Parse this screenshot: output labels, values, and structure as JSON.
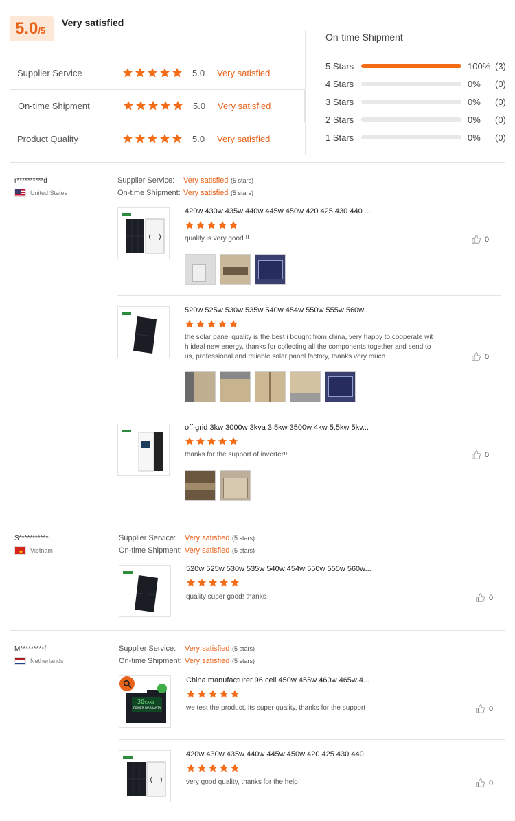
{
  "summary": {
    "score": "5.0",
    "score_max": "/5",
    "overall_text": "Very satisfied",
    "rows": [
      {
        "label": "Supplier Service",
        "value": "5.0",
        "satisfaction": "Very satisfied",
        "stars": 5
      },
      {
        "label": "On-time Shipment",
        "value": "5.0",
        "satisfaction": "Very satisfied",
        "stars": 5
      },
      {
        "label": "Product Quality",
        "value": "5.0",
        "satisfaction": "Very satisfied",
        "stars": 5
      }
    ]
  },
  "shipment": {
    "title": "On-time Shipment",
    "bars": [
      {
        "label": "5  Stars",
        "pct": "100%",
        "count": "(3)",
        "fill": 1.0
      },
      {
        "label": "4  Stars",
        "pct": "0%",
        "count": "(0)",
        "fill": 0
      },
      {
        "label": "3  Stars",
        "pct": "0%",
        "count": "(0)",
        "fill": 0
      },
      {
        "label": "2  Stars",
        "pct": "0%",
        "count": "(0)",
        "fill": 0
      },
      {
        "label": "1  Stars",
        "pct": "0%",
        "count": "(0)",
        "fill": 0
      }
    ]
  },
  "meta_labels": {
    "supplier_service": "Supplier Service:",
    "ontime_shipment": "On-time Shipment:",
    "very_satisfied": "Very satisfied",
    "five_stars": "(5 stars)"
  },
  "reviews": [
    {
      "name": "r**********d",
      "country": "United States",
      "products": [
        {
          "title": "420w 430w 435w 440w 445w 450w 420 425 430 440 ...",
          "comment": "quality is very good  !!",
          "likes": "0",
          "stars": 5
        },
        {
          "title": "520w 525w 530w 535w 540w 454w 550w 555w 560w...",
          "comment_lines": [
            "the solar panel quality is the best i bought from china, very happy to cooperate wit",
            "h ideal new energy, thanks for collecting all the components together and send to",
            "us, professional and reliable solar panel factory, thanks very much"
          ],
          "likes": "0",
          "stars": 5
        },
        {
          "title": "off grid 3kw 3000w 3kva 3.5kw 3500w 4kw 5.5kw 5kv...",
          "comment": "thanks for the support of inverter!!",
          "likes": "0",
          "stars": 5
        }
      ]
    },
    {
      "name": "S***********i",
      "country": "Vietnam",
      "products": [
        {
          "title": "520w 525w 530w 535w 540w 454w 550w 555w 560w...",
          "comment": "quality super good! thanks",
          "likes": "0",
          "stars": 5
        }
      ]
    },
    {
      "name": "M*********f",
      "country": "Netherlands",
      "products": [
        {
          "title": "China manufacturer 96 cell 450w 455w 460w 465w 4...",
          "comment": "we test the product, its super quality, thanks for the support",
          "likes": "0",
          "stars": 5,
          "thumb_text": [
            "30",
            "YEARS",
            "POWER WARRANTY"
          ]
        },
        {
          "title": "420w 430w 435w 440w 445w 450w 420 425 430 440 ...",
          "comment": "very good quality, thanks for the help",
          "likes": "0",
          "stars": 5
        }
      ]
    }
  ],
  "colors": {
    "accent": "#f36d19",
    "text_accent": "#e8621a",
    "badge_bg": "#fde7d7"
  },
  "icons": [
    "star-icon",
    "thumbs-up-icon",
    "search-icon",
    "flag-us-icon",
    "flag-vn-icon",
    "flag-nl-icon"
  ]
}
